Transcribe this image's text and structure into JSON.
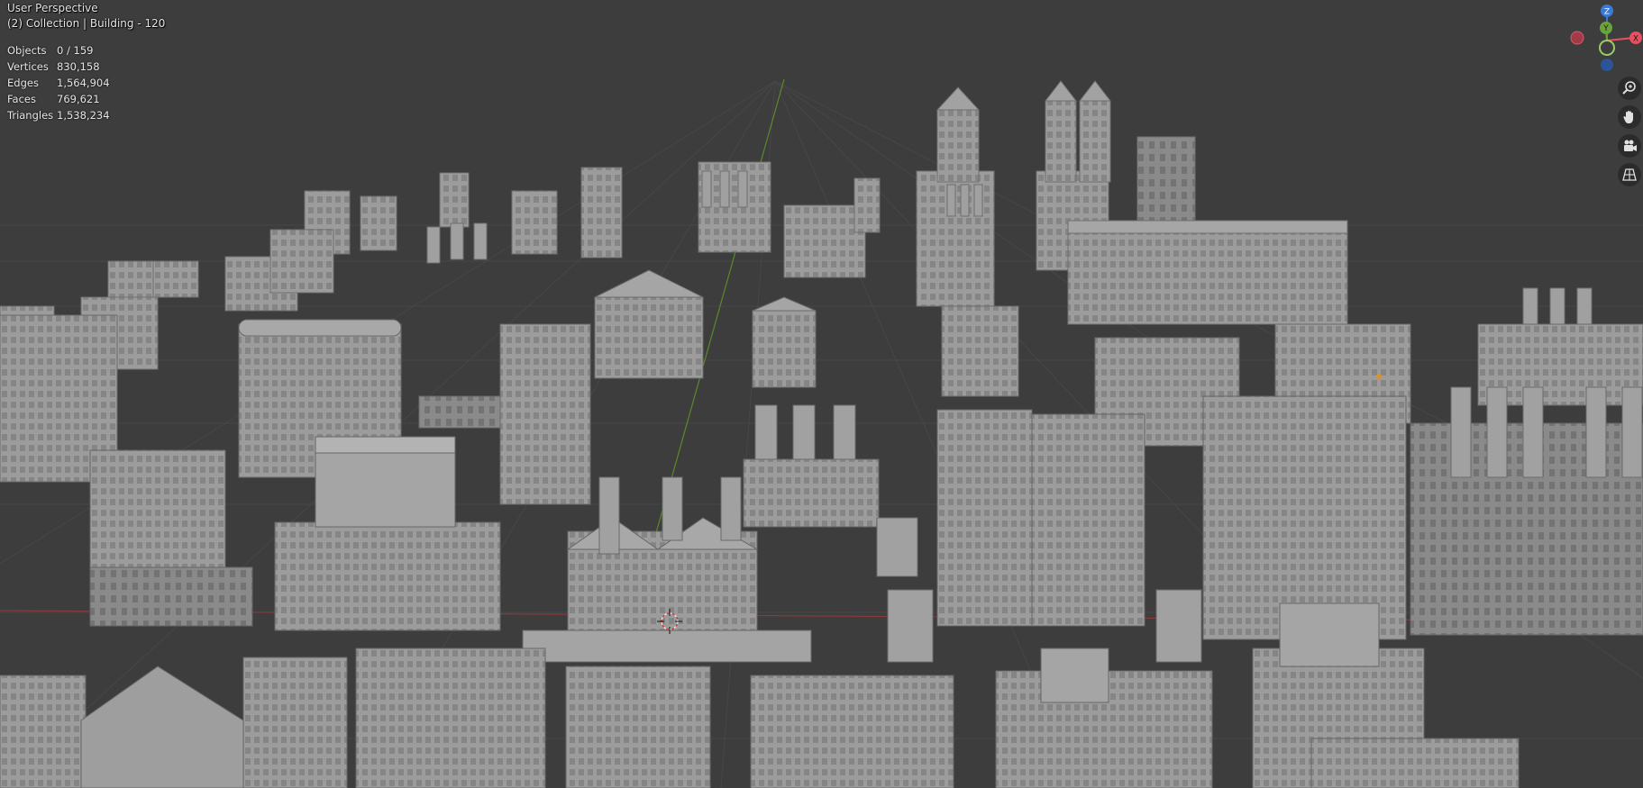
{
  "viewport": {
    "title": "User Perspective",
    "collection": "(2) Collection | Building - 120",
    "stats": [
      {
        "label": "Objects",
        "value": "0 / 159"
      },
      {
        "label": "Vertices",
        "value": "830,158"
      },
      {
        "label": "Edges",
        "value": "1,564,904"
      },
      {
        "label": "Faces",
        "value": "769,621"
      },
      {
        "label": "Triangles",
        "value": "1,538,234"
      }
    ]
  },
  "gizmo": {
    "z_label": "Z",
    "y_label": "Y",
    "x_label": "X",
    "colors": {
      "x": "#e8505f",
      "y": "#6aa33a",
      "z": "#3a7ad6",
      "x_neg": "#a43a48",
      "y_neg": "#4f7a2d",
      "z_neg": "#2b5596"
    }
  },
  "nav_tools": [
    {
      "icon": "zoom-icon"
    },
    {
      "icon": "hand-pan-icon"
    },
    {
      "icon": "camera-icon"
    },
    {
      "icon": "grid-perspective-icon"
    }
  ],
  "colors": {
    "background": "#3d3d3d",
    "grid": "#474747",
    "building": "#9a9a9a",
    "x_axis_line": "#8a3a3a",
    "y_axis_line": "#5a8a2a"
  }
}
